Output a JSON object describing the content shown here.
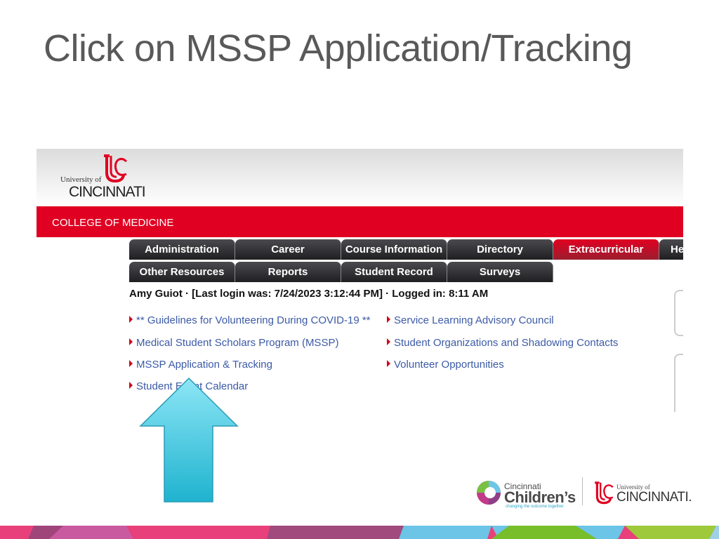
{
  "slide": {
    "title": "Click on MSSP Application/Tracking"
  },
  "portal": {
    "logo": {
      "univ_of": "University of",
      "name": "CINCINNATI"
    },
    "college_bar": "COLLEGE OF MEDICINE",
    "tabs_row1": [
      {
        "label": "Administration",
        "active": false
      },
      {
        "label": "Career",
        "active": false
      },
      {
        "label": "Course Information",
        "active": false
      },
      {
        "label": "Directory",
        "active": false
      },
      {
        "label": "Extracurricular",
        "active": true
      },
      {
        "label": "He",
        "active": false
      }
    ],
    "tabs_row2": [
      {
        "label": "Other Resources"
      },
      {
        "label": "Reports"
      },
      {
        "label": "Student Record"
      },
      {
        "label": "Surveys"
      }
    ],
    "login_line": "Amy Guiot · [Last login was: 7/24/2023 3:12:44 PM] · Logged in: 8:11 AM",
    "links_left": [
      "** Guidelines for Volunteering During COVID-19 **",
      "Medical Student Scholars Program (MSSP)",
      "MSSP Application & Tracking",
      "Student Event Calendar"
    ],
    "links_right": [
      "Service Learning Advisory Council",
      "Student Organizations and Shadowing Contacts",
      "Volunteer Opportunities"
    ]
  },
  "footer": {
    "cc_line1": "Cincinnati",
    "cc_line2": "Children’s",
    "cc_tagline": "changing the outcome together",
    "uc_univ_of": "University of",
    "uc_name": "CINCINNATI."
  },
  "colors": {
    "uc_red": "#e00122",
    "link_blue": "#3b5aa6",
    "arrow_cyan": "#5fcfe6",
    "title_gray": "#595959"
  }
}
